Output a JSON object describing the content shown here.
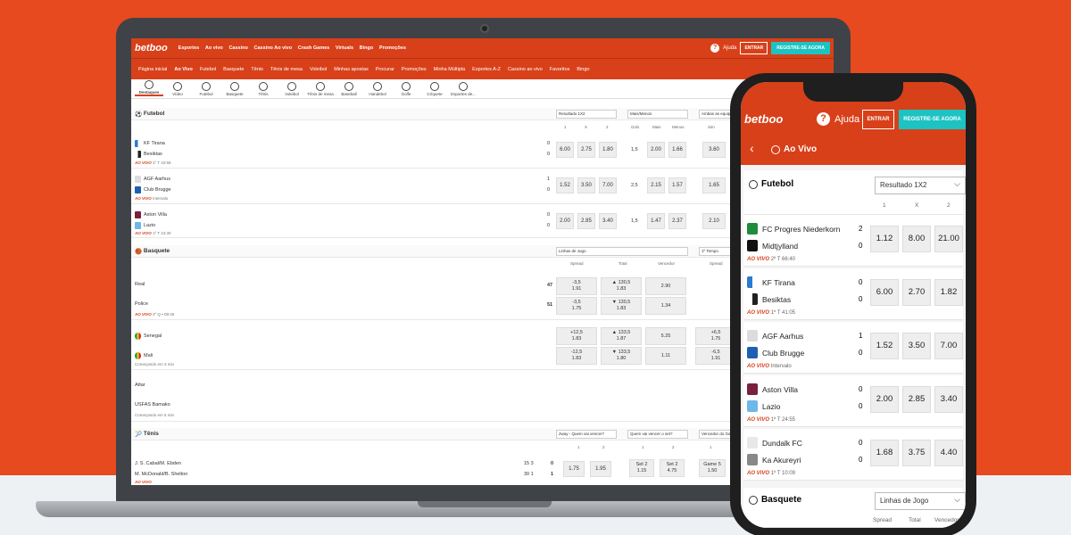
{
  "brand": "betboo",
  "desktop": {
    "topnav": [
      "Esportes",
      "Ao vivo",
      "Cassino",
      "Cassino Ao vivo",
      "Crash Games",
      "Virtuals",
      "Bingo",
      "Promoções"
    ],
    "help": "Ajuda",
    "login": "ENTRAR",
    "register": "REGISTRE-SE AGORA",
    "subnav": [
      "Página inicial",
      "Ao Vivo",
      "Futebol",
      "Basquete",
      "Tênis",
      "Tênis de mesa",
      "Voleibol",
      "Minhas apostas",
      "Procurar",
      "Promoções",
      "Minha Múltipla",
      "Esportes A-Z",
      "Cassino ao vivo",
      "Favoritos",
      "Bingo"
    ],
    "sports": [
      "Destaques",
      "Vídeo",
      "Futebol",
      "Basquete",
      "Tênis",
      "Voleibol",
      "Tênis de mesa",
      "Baseball",
      "Handebol",
      "Golfe",
      "Críquete",
      "Esportes de..."
    ],
    "football": {
      "title": "Futebol",
      "selects": [
        "Resultado 1X2",
        "Mais/Menos",
        "Ambas as equip..."
      ],
      "cols": [
        "1",
        "X",
        "2",
        "Gols",
        "Mais",
        "Menos",
        "Sim"
      ],
      "matches": [
        {
          "home": "KF Tirana",
          "away": "Besiktas",
          "hs": "0",
          "as": "0",
          "live": "AO VIVO",
          "time": "1º T 42:58",
          "o1": "6.00",
          "ox": "2.75",
          "o2": "1.80",
          "gl": "1,5",
          "mais": "2.00",
          "menos": "1.66",
          "sim": "3.60"
        },
        {
          "home": "AGF Aarhus",
          "away": "Club Brugge",
          "hs": "1",
          "as": "0",
          "live": "AO VIVO",
          "time": "Intervalo",
          "o1": "1.52",
          "ox": "3.50",
          "o2": "7.00",
          "gl": "2,5",
          "mais": "2.15",
          "menos": "1.57",
          "sim": "1.65"
        },
        {
          "home": "Aston Villa",
          "away": "Lazio",
          "hs": "0",
          "as": "0",
          "live": "AO VIVO",
          "time": "1º T 24:30",
          "o1": "2.00",
          "ox": "2.85",
          "o2": "3.40",
          "gl": "1,5",
          "mais": "1.47",
          "menos": "2.37",
          "sim": "2.10"
        }
      ]
    },
    "basketball": {
      "title": "Basquete",
      "selects": [
        "Linhas de Jogo",
        "1º Tempo"
      ],
      "cols": [
        "Spread",
        "Total",
        "Vencedor",
        "Spread"
      ],
      "m1": {
        "home": "Real",
        "away": "Police",
        "hs": "47",
        "as": "51",
        "live": "AO VIVO",
        "time": "4º Q • 09:45",
        "sp1a": "-3,5",
        "sp1b": "1.91",
        "sp2a": "-3,5",
        "sp2b": "1.75",
        "t1a": "▲ 130,5",
        "t1b": "1.83",
        "t2a": "▼ 130,5",
        "t2b": "1.83",
        "w1": "2.90",
        "w2": "1.34"
      },
      "m2": {
        "home": "Senegal",
        "away": "Mali",
        "status": "Começando em 3 min",
        "sp1a": "+12,5",
        "sp1b": "1.83",
        "sp2a": "-12,5",
        "sp2b": "1.83",
        "t1a": "▲ 133,5",
        "t1b": "1.87",
        "t2a": "▼ 133,5",
        "t2b": "1.80",
        "w1": "5.25",
        "w2": "1.11",
        "s1a": "+6,5",
        "s1b": "1.75",
        "s2a": "-6,5",
        "s2b": "1.91"
      },
      "m3": {
        "home": "Attar",
        "away": "USFAS Bamako",
        "status": "Começando em 5 min"
      }
    },
    "tennis": {
      "title": "Tênis",
      "selects": [
        "2way - Quem vai vencer?",
        "Quem vai vencer o set?",
        "Vencedor do Ga..."
      ],
      "cols": [
        "1",
        "2",
        "1",
        "2",
        "1"
      ],
      "match": {
        "p1": "J. S. Cabal/M. Ebden",
        "p2": "M. McDonald/B. Shelton",
        "s1": "15 3",
        "s2": "30 1",
        "g1": "0",
        "g2": "1",
        "live": "AO VIVO",
        "o1": "1.75",
        "o2": "1.95",
        "set1": "Set 2",
        "set1o": "1.15",
        "set2": "Set 2",
        "set2o": "4.75",
        "game": "Game 5",
        "gameo": "1.50"
      }
    }
  },
  "mobile": {
    "help": "Ajuda",
    "login": "ENTRAR",
    "register": "REGISTRE-SE AGORA",
    "page_title": "Ao Vivo",
    "football_title": "Futebol",
    "football_select": "Resultado 1X2",
    "cols": [
      "1",
      "X",
      "2"
    ],
    "matches": [
      {
        "home": "FC Progres Niederkorn",
        "away": "Midtjylland",
        "hs": "2",
        "as": "0",
        "live": "AO VIVO",
        "time": "2º T 66:40",
        "o1": "1.12",
        "ox": "8.00",
        "o2": "21.00"
      },
      {
        "home": "KF Tirana",
        "away": "Besiktas",
        "hs": "0",
        "as": "0",
        "live": "AO VIVO",
        "time": "1º T 41:05",
        "o1": "6.00",
        "ox": "2.70",
        "o2": "1.82"
      },
      {
        "home": "AGF Aarhus",
        "away": "Club Brugge",
        "hs": "1",
        "as": "0",
        "live": "AO VIVO",
        "time": "Intervalo",
        "o1": "1.52",
        "ox": "3.50",
        "o2": "7.00"
      },
      {
        "home": "Aston Villa",
        "away": "Lazio",
        "hs": "0",
        "as": "0",
        "live": "AO VIVO",
        "time": "1º T 24:55",
        "o1": "2.00",
        "ox": "2.85",
        "o2": "3.40"
      },
      {
        "home": "Dundalk FC",
        "away": "Ka Akureyri",
        "hs": "0",
        "as": "0",
        "live": "AO VIVO",
        "time": "1º T 10:09",
        "o1": "1.68",
        "ox": "3.75",
        "o2": "4.40"
      }
    ],
    "basketball_title": "Basquete",
    "basketball_select": "Linhas de Jogo",
    "basketball_cols": [
      "Spread",
      "Total",
      "Vencedor"
    ]
  },
  "colors": {
    "brand": "#d8401a",
    "accent": "#1cc3c2",
    "background": "#e64a1e"
  }
}
